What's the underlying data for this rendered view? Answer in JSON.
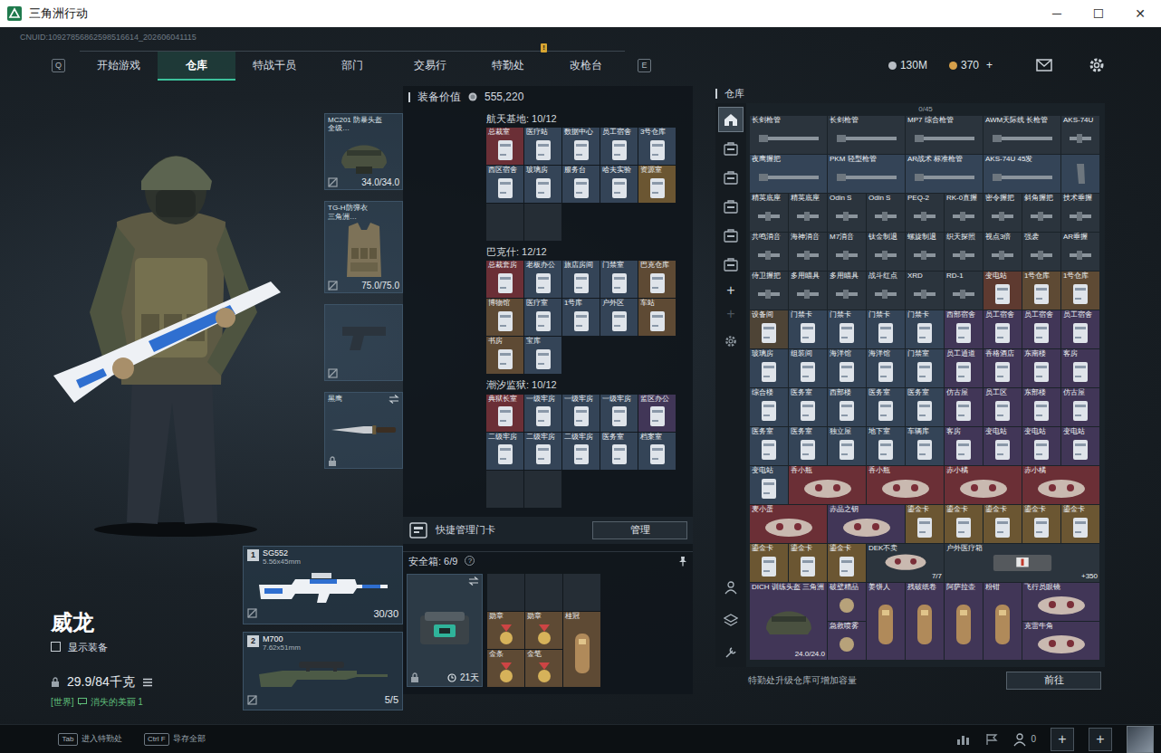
{
  "window": {
    "title": "三角洲行动",
    "controls": [
      "─",
      "☐",
      "✕"
    ]
  },
  "uid": "CNUID:10927856862598516614_202606041115",
  "nav": {
    "prev_key": "Q",
    "next_key": "E",
    "tabs": [
      {
        "label": "开始游戏",
        "selected": false
      },
      {
        "label": "仓库",
        "selected": true
      },
      {
        "label": "特战干员",
        "selected": false
      },
      {
        "label": "部门",
        "selected": false
      },
      {
        "label": "交易行",
        "selected": false
      },
      {
        "label": "特勤处",
        "selected": false,
        "badge": "!"
      },
      {
        "label": "改枪台",
        "selected": false
      }
    ]
  },
  "currency": [
    {
      "value": "130M",
      "color": "#b9bec4"
    },
    {
      "value": "370",
      "color": "#d6a04a"
    }
  ],
  "currency_add": "+",
  "operator": {
    "name": "威龙",
    "show_equipment": {
      "label": "显示装备",
      "checked": false
    },
    "weight": "29.9/84千克",
    "chat": {
      "channel": "[世界]",
      "text": "消失的美丽 1"
    }
  },
  "gear_slots": [
    {
      "kind": "helmet",
      "name": "MC201 防暴头盔",
      "sub": "全级…",
      "durability": "34.0/34.0"
    },
    {
      "kind": "armor",
      "name": "TG-H防弹衣",
      "sub": "三角洲…",
      "durability": "75.0/75.0"
    },
    {
      "kind": "pistol"
    },
    {
      "kind": "melee",
      "name": "黑鹰"
    }
  ],
  "weapons": [
    {
      "index": "1",
      "name": "SG552",
      "caliber": "5.56x45mm",
      "ammo": "30/30"
    },
    {
      "index": "2",
      "name": "M700",
      "caliber": "7.62x51mm",
      "ammo": "5/5"
    }
  ],
  "loadout": {
    "label": "装备价值",
    "value": "555,220",
    "sections": [
      {
        "title": "航天基地: 10/12",
        "slots": [
          {
            "kind": "card",
            "label": "总裁室",
            "color": "#6b2f36"
          },
          {
            "kind": "card",
            "label": "医疗站",
            "color": "#344457"
          },
          {
            "kind": "card",
            "label": "数据中心",
            "color": "#344457"
          },
          {
            "kind": "card",
            "label": "员工宿舍",
            "color": "#344457"
          },
          {
            "kind": "card",
            "label": "3号仓库",
            "color": "#344457"
          },
          {
            "kind": "card",
            "label": "西区宿舍",
            "color": "#344457"
          },
          {
            "kind": "card",
            "label": "玻璃房",
            "color": "#344457"
          },
          {
            "kind": "card",
            "label": "服务台",
            "color": "#344457"
          },
          {
            "kind": "card",
            "label": "哈夫实验",
            "color": "#344457"
          },
          {
            "kind": "card",
            "label": "资源室",
            "color": "#6b5632"
          },
          {
            "kind": "empty"
          },
          {
            "kind": "empty"
          }
        ]
      },
      {
        "title": "巴克什: 12/12",
        "slots": [
          {
            "kind": "card",
            "label": "总裁套房",
            "color": "#6b2f36"
          },
          {
            "kind": "card",
            "label": "老板办公",
            "color": "#344457"
          },
          {
            "kind": "card",
            "label": "旅店房间",
            "color": "#344457"
          },
          {
            "kind": "card",
            "label": "门禁室",
            "color": "#344457"
          },
          {
            "kind": "card",
            "label": "巴克仓库",
            "color": "#5e4a34"
          },
          {
            "kind": "card",
            "label": "博物馆",
            "color": "#5e4a34"
          },
          {
            "kind": "card",
            "label": "医疗室",
            "color": "#344457"
          },
          {
            "kind": "card",
            "label": "1号库",
            "color": "#344457"
          },
          {
            "kind": "card",
            "label": "户外区",
            "color": "#344457"
          },
          {
            "kind": "card",
            "label": "车站",
            "color": "#5e4a34"
          },
          {
            "kind": "card",
            "label": "书房",
            "color": "#5e4a34"
          },
          {
            "kind": "card",
            "label": "宝库",
            "color": "#344457"
          }
        ]
      },
      {
        "title": "潮汐监狱: 10/12",
        "slots": [
          {
            "kind": "card",
            "label": "典狱长室",
            "color": "#6b2f36"
          },
          {
            "kind": "card",
            "label": "一级牢房",
            "color": "#344457"
          },
          {
            "kind": "card",
            "label": "一级牢房",
            "color": "#344457"
          },
          {
            "kind": "card",
            "label": "一级牢房",
            "color": "#344457"
          },
          {
            "kind": "card",
            "label": "监区办公",
            "color": "#413657"
          },
          {
            "kind": "card",
            "label": "二级牢房",
            "color": "#344457"
          },
          {
            "kind": "card",
            "label": "二级牢房",
            "color": "#344457"
          },
          {
            "kind": "card",
            "label": "二级牢房",
            "color": "#344457"
          },
          {
            "kind": "card",
            "label": "医务室",
            "color": "#344457"
          },
          {
            "kind": "card",
            "label": "档案室",
            "color": "#344457"
          },
          {
            "kind": "empty"
          },
          {
            "kind": "empty"
          }
        ]
      }
    ]
  },
  "card_manage": {
    "label": "快捷管理门卡",
    "button": "管理"
  },
  "safe_box": {
    "label": "安全箱: 6/9",
    "help": "?",
    "timer": "21天",
    "slots": [
      {
        "kind": "empty"
      },
      {
        "kind": "empty"
      },
      {
        "kind": "empty"
      },
      {
        "kind": "item",
        "label": "勋章",
        "color": "#5e4a34"
      },
      {
        "kind": "item",
        "label": "勋章",
        "color": "#5e4a34"
      },
      {
        "kind": "tall",
        "label": "桂冠",
        "color": "#5e4a34"
      },
      {
        "kind": "item",
        "label": "金条",
        "color": "#5e4a34"
      },
      {
        "kind": "item",
        "label": "金笔",
        "color": "#5e4a34"
      }
    ]
  },
  "warehouse": {
    "title": "仓库",
    "capacity": "0/45",
    "tabs": [
      {
        "selected": true
      },
      {
        "selected": false
      },
      {
        "selected": false
      },
      {
        "selected": false
      },
      {
        "selected": false
      },
      {
        "selected": false
      }
    ],
    "actions": [
      {
        "label": "+",
        "disabled": false
      },
      {
        "label": "+",
        "disabled": true
      }
    ],
    "items": [
      {
        "label": "长剑枪管",
        "kind": "barrel",
        "color": "#2b343d"
      },
      {
        "label": "长剑枪管",
        "kind": "barrel",
        "color": "#2b343d"
      },
      {
        "label": "MP7 综合枪管",
        "kind": "barrel",
        "color": "#2b343d"
      },
      {
        "label": "AWM天际线 长枪管",
        "kind": "barrel",
        "color": "#2b343d"
      },
      {
        "label": "AKS-74U",
        "kind": "part",
        "color": "#2b343d"
      },
      {
        "label": "夜鹰握把",
        "kind": "barrel",
        "color": "#344457"
      },
      {
        "label": "PKM 轻型枪管",
        "kind": "barrel",
        "color": "#344457"
      },
      {
        "label": "AR战术 标准枪管",
        "kind": "barrel",
        "color": "#344457"
      },
      {
        "label": "AKS-74U 45发",
        "kind": "barrel",
        "color": "#344457"
      },
      {
        "kind": "mag",
        "color": "#344457"
      },
      {
        "label": "精英底座",
        "kind": "part",
        "color": "#2b343d"
      },
      {
        "label": "精英底座",
        "kind": "part",
        "color": "#2b343d"
      },
      {
        "label": "Odin S",
        "kind": "part",
        "color": "#2b343d"
      },
      {
        "label": "Odin S",
        "kind": "part",
        "color": "#2b343d"
      },
      {
        "label": "PEQ-2",
        "kind": "part",
        "color": "#2b343d"
      },
      {
        "label": "RK-0直握",
        "kind": "part",
        "color": "#2b343d"
      },
      {
        "label": "密令握把",
        "kind": "part",
        "color": "#2b343d"
      },
      {
        "label": "斜角握把",
        "kind": "part",
        "color": "#2b343d"
      },
      {
        "label": "技术垂握",
        "kind": "part",
        "color": "#2b343d"
      },
      {
        "label": "共鸣消音",
        "kind": "part",
        "color": "#2b343d"
      },
      {
        "label": "海神消音",
        "kind": "part",
        "color": "#2b343d"
      },
      {
        "label": "M7消音",
        "kind": "part",
        "color": "#2b343d"
      },
      {
        "label": "钛金制退",
        "kind": "part",
        "color": "#2b343d"
      },
      {
        "label": "螺旋制退",
        "kind": "part",
        "color": "#2b343d"
      },
      {
        "label": "织天探照",
        "kind": "part",
        "color": "#2b343d"
      },
      {
        "label": "视点3倍",
        "kind": "part",
        "color": "#2b343d"
      },
      {
        "label": "强袭",
        "kind": "part",
        "color": "#2b343d"
      },
      {
        "label": "AR垂握",
        "kind": "part",
        "color": "#2b343d"
      },
      {
        "label": "侍卫握把",
        "kind": "part",
        "color": "#2b343d"
      },
      {
        "label": "多用瞄具",
        "kind": "part",
        "color": "#2b343d"
      },
      {
        "label": "多用瞄具",
        "kind": "part",
        "color": "#2b343d"
      },
      {
        "label": "战斗红点",
        "kind": "part",
        "color": "#2b343d"
      },
      {
        "label": "XRD",
        "kind": "part",
        "color": "#2b343d"
      },
      {
        "label": "RD-1",
        "kind": "part",
        "color": "#2b343d"
      },
      {
        "label": "变电站",
        "kind": "card",
        "color": "#5e3a30"
      },
      {
        "label": "1号仓库",
        "kind": "card",
        "color": "#5e4a34"
      },
      {
        "label": "1号仓库",
        "kind": "card",
        "color": "#5e4a34"
      },
      {
        "label": "设备间",
        "kind": "card",
        "color": "#4e4436"
      },
      {
        "label": "门禁卡",
        "kind": "card",
        "color": "#344457"
      },
      {
        "label": "门禁卡",
        "kind": "card",
        "color": "#344457"
      },
      {
        "label": "门禁卡",
        "kind": "card",
        "color": "#344457"
      },
      {
        "label": "门禁卡",
        "kind": "card",
        "color": "#344457"
      },
      {
        "label": "西部宿舍",
        "kind": "card",
        "color": "#413657"
      },
      {
        "label": "员工宿舍",
        "kind": "card",
        "color": "#413657"
      },
      {
        "label": "员工宿舍",
        "kind": "card",
        "color": "#413657"
      },
      {
        "label": "员工宿舍",
        "kind": "card",
        "color": "#413657"
      },
      {
        "label": "玻璃房",
        "kind": "card",
        "color": "#344457"
      },
      {
        "label": "组装间",
        "kind": "card",
        "color": "#344457"
      },
      {
        "label": "海洋馆",
        "kind": "card",
        "color": "#344457"
      },
      {
        "label": "海洋馆",
        "kind": "card",
        "color": "#344457"
      },
      {
        "label": "门禁室",
        "kind": "card",
        "color": "#344457"
      },
      {
        "label": "员工通道",
        "kind": "card",
        "color": "#413657"
      },
      {
        "label": "香格酒店",
        "kind": "card",
        "color": "#413657"
      },
      {
        "label": "东南楼",
        "kind": "card",
        "color": "#413657"
      },
      {
        "label": "客房",
        "kind": "card",
        "color": "#413657"
      },
      {
        "label": "综合楼",
        "kind": "card",
        "color": "#344457"
      },
      {
        "label": "医务室",
        "kind": "card",
        "color": "#344457"
      },
      {
        "label": "西部楼",
        "kind": "card",
        "color": "#344457"
      },
      {
        "label": "医务室",
        "kind": "card",
        "color": "#344457"
      },
      {
        "label": "医务室",
        "kind": "card",
        "color": "#344457"
      },
      {
        "label": "仿古屋",
        "kind": "card",
        "color": "#413657"
      },
      {
        "label": "员工区",
        "kind": "card",
        "color": "#413657"
      },
      {
        "label": "东部楼",
        "kind": "card",
        "color": "#413657"
      },
      {
        "label": "仿古屋",
        "kind": "card",
        "color": "#413657"
      },
      {
        "label": "医务室",
        "kind": "card",
        "color": "#344457"
      },
      {
        "label": "医务室",
        "kind": "card",
        "color": "#344457"
      },
      {
        "label": "独立屋",
        "kind": "card",
        "color": "#344457"
      },
      {
        "label": "地下室",
        "kind": "card",
        "color": "#344457"
      },
      {
        "label": "车辆库",
        "kind": "card",
        "color": "#344457"
      },
      {
        "label": "客房",
        "kind": "card",
        "color": "#413657"
      },
      {
        "label": "变电站",
        "kind": "card",
        "color": "#413657"
      },
      {
        "label": "变电站",
        "kind": "card",
        "color": "#413657"
      },
      {
        "label": "变电站",
        "kind": "card",
        "color": "#413657"
      },
      {
        "label": "变电站",
        "kind": "card",
        "color": "#344457"
      },
      {
        "label": "香小瓶",
        "kind": "wide",
        "color": "#6b2f36"
      },
      {
        "label": "香小瓶",
        "kind": "wide",
        "color": "#6b2f36"
      },
      {
        "label": "赤小橘",
        "kind": "wide",
        "color": "#6b2f36"
      },
      {
        "label": "赤小橘",
        "kind": "wide",
        "color": "#6b2f36"
      },
      {
        "label": "麦小蛋",
        "kind": "wide",
        "color": "#6b2f36"
      },
      {
        "label": "赤晶之钥",
        "kind": "wide",
        "color": "#413657"
      },
      {
        "label": "鎏金卡",
        "kind": "card",
        "color": "#6b5632"
      },
      {
        "label": "鎏金卡",
        "kind": "card",
        "color": "#6b5632"
      },
      {
        "label": "鎏金卡",
        "kind": "card",
        "color": "#6b5632"
      },
      {
        "label": "鎏金卡",
        "kind": "card",
        "color": "#6b5632"
      },
      {
        "label": "鎏金卡",
        "kind": "card",
        "color": "#6b5632"
      },
      {
        "label": "鎏金卡",
        "kind": "card",
        "color": "#6b5632"
      },
      {
        "label": "鎏金卡",
        "kind": "card",
        "color": "#6b5632"
      },
      {
        "label": "鎏金卡",
        "kind": "card",
        "color": "#6b5632"
      },
      {
        "label": "DEK不卖",
        "kind": "wide",
        "color": "#2b343d",
        "note": "7/7"
      },
      {
        "label": "户外医疗箱",
        "kind": "box4",
        "color": "#2b343d",
        "note": "+350"
      },
      {
        "label": "DICH 训练头盔 三角洲",
        "kind": "gear",
        "color": "#413657",
        "note": "24.0/24.0"
      },
      {
        "label": "破壁精品",
        "kind": "obj",
        "color": "#413657"
      },
      {
        "label": "姜饼人",
        "kind": "tall",
        "color": "#413657"
      },
      {
        "label": "残破纸卷",
        "kind": "tall",
        "color": "#413657"
      },
      {
        "label": "阿萨拉壶",
        "kind": "tall",
        "color": "#413657"
      },
      {
        "label": "粉钳",
        "kind": "tall",
        "color": "#413657"
      },
      {
        "label": "飞行员眼镜",
        "kind": "wide",
        "color": "#413657"
      },
      {
        "label": "急救喷雾",
        "kind": "obj",
        "color": "#413657"
      },
      {
        "label": "克雷牛角",
        "kind": "wide",
        "color": "#413657"
      }
    ],
    "footer": "特勤处升级仓库可增加容量",
    "button": "前往"
  },
  "bottom_bar": {
    "hints": [
      {
        "key": "Tab",
        "label": "进入特勤处"
      },
      {
        "key": "Ctrl F",
        "label": "导存全部"
      }
    ],
    "friends": "0",
    "slots": [
      "+",
      "+"
    ]
  }
}
